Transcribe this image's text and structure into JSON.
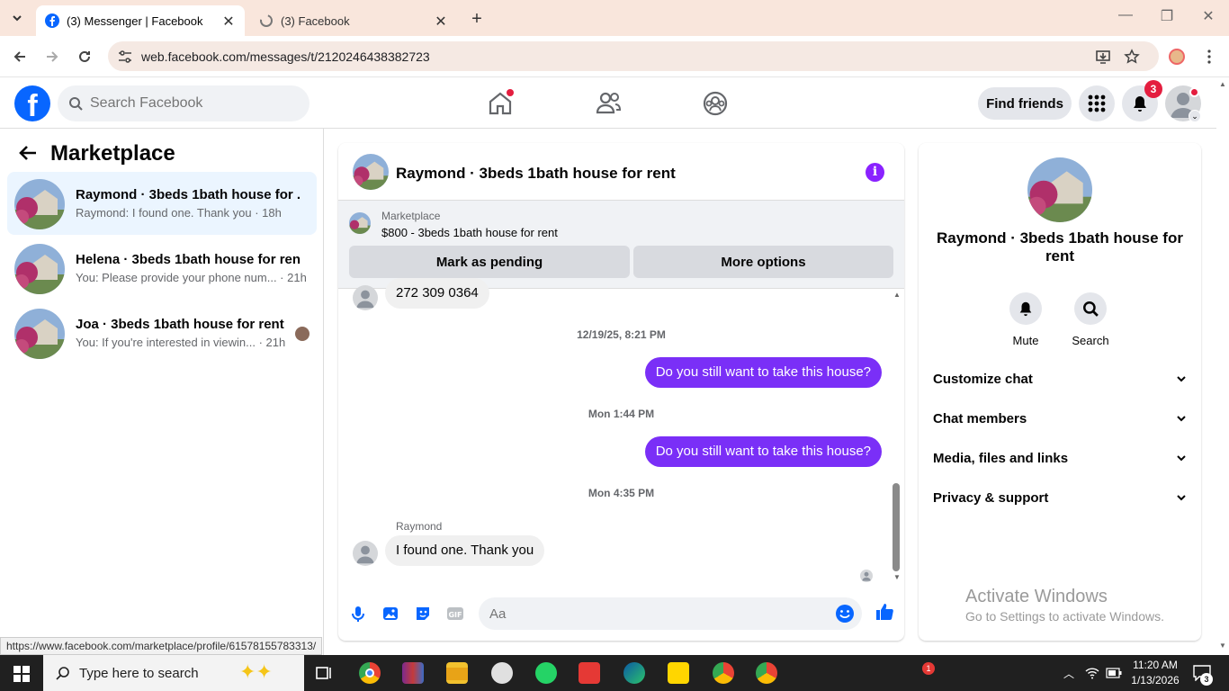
{
  "browser": {
    "tabs": [
      {
        "title": "(3) Messenger | Facebook"
      },
      {
        "title": "(3) Facebook"
      }
    ],
    "url": "web.facebook.com/messages/t/2120246438382723",
    "status_url": "https://www.facebook.com/marketplace/profile/61578155783313/"
  },
  "fb": {
    "search_placeholder": "Search Facebook",
    "find_friends": "Find friends",
    "notif_count": "3",
    "brand_color": "#0866ff"
  },
  "sidebar": {
    "title": "Marketplace",
    "conversations": [
      {
        "name": "Raymond · 3beds 1bath house for ...",
        "snippet": "Raymond: I found one. Thank you · 18h"
      },
      {
        "name": "Helena · 3beds 1bath house for rent",
        "snippet": "You: Please provide your phone num... · 21h"
      },
      {
        "name": "Joa · 3beds 1bath house for rent",
        "snippet": "You: If you're interested in viewin... · 21h"
      }
    ]
  },
  "chat": {
    "title": "Raymond · 3beds 1bath house for rent",
    "listing": {
      "label": "Marketplace",
      "price_title": "$800 - 3beds 1bath house for rent"
    },
    "mark_pending": "Mark as pending",
    "more_options": "More options",
    "messages": [
      {
        "text": "272 309 0364"
      },
      {
        "ts": "12/19/25, 8:21 PM"
      },
      {
        "text": "Do you still want to take this house?"
      },
      {
        "ts": "Mon 1:44 PM"
      },
      {
        "text": "Do you still want to take this house?"
      },
      {
        "ts": "Mon 4:35 PM"
      },
      {
        "sender": "Raymond"
      },
      {
        "text": "I found one. Thank you"
      }
    ],
    "composer_placeholder": "Aa",
    "accent": "#7a2ff7"
  },
  "details": {
    "name": "Raymond · 3beds 1bath house for rent",
    "actions": [
      {
        "label": "Mute"
      },
      {
        "label": "Search"
      }
    ],
    "sections": [
      {
        "label": "Customize chat"
      },
      {
        "label": "Chat members"
      },
      {
        "label": "Media, files and links"
      },
      {
        "label": "Privacy & support"
      }
    ]
  },
  "watermark": {
    "line1": "Activate Windows",
    "line2": "Go to Settings to activate Windows."
  },
  "taskbar": {
    "search_placeholder": "Type here to search",
    "time": "11:20 AM",
    "date": "1/13/2026",
    "notif": "3",
    "app_badge": "1"
  }
}
